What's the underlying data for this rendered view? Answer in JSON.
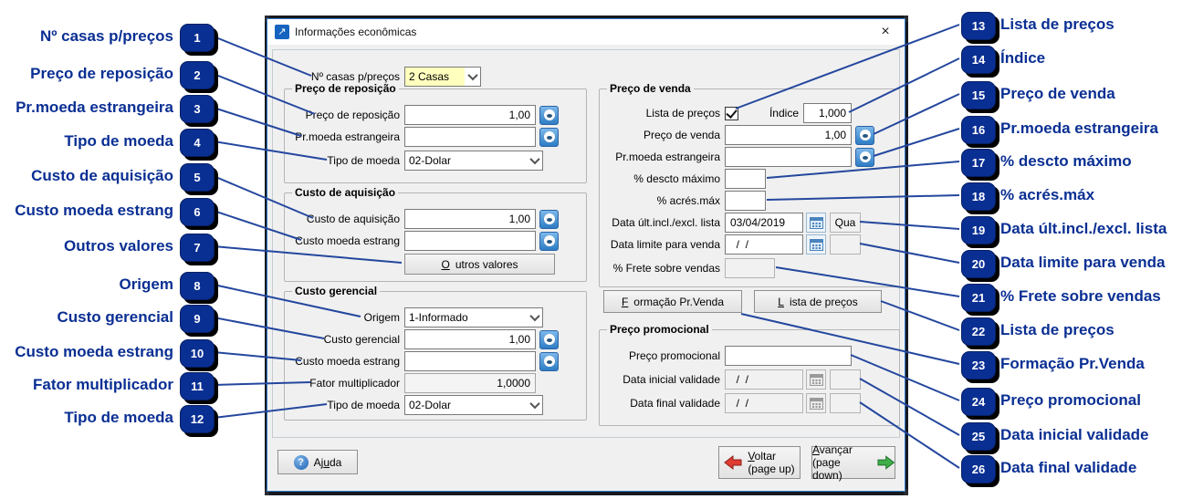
{
  "window": {
    "title": "Informações econômicas",
    "close_glyph": "×",
    "app_icon_glyph": "↗"
  },
  "header_field": {
    "label": "Nº casas p/preços",
    "value": "2 Casas"
  },
  "groups": {
    "preco_reposicao": {
      "title": "Preço de reposição",
      "preco_reposicao": {
        "label": "Preço de reposição",
        "value": "1,00"
      },
      "pr_moeda_estrangeira": {
        "label": "Pr.moeda estrangeira",
        "value": ""
      },
      "tipo_moeda": {
        "label": "Tipo de moeda",
        "value": "02-Dolar"
      }
    },
    "custo_aquisicao": {
      "title": "Custo de aquisição",
      "custo_aquisicao": {
        "label": "Custo de aquisição",
        "value": "1,00"
      },
      "custo_moeda_estrang": {
        "label": "Custo moeda estrang",
        "value": ""
      },
      "outros_valores": {
        "label": "Outros valores",
        "accel": 0
      }
    },
    "custo_gerencial": {
      "title": "Custo gerencial",
      "origem": {
        "label": "Origem",
        "value": "1-Informado"
      },
      "custo_gerencial": {
        "label": "Custo gerencial",
        "value": "1,00"
      },
      "custo_moeda_estrang": {
        "label": "Custo moeda estrang",
        "value": ""
      },
      "fator_multiplicador": {
        "label": "Fator multiplicador",
        "value": "1,0000"
      },
      "tipo_moeda": {
        "label": "Tipo de moeda",
        "value": "02-Dolar"
      }
    },
    "preco_venda": {
      "title": "Preço de venda",
      "lista_precos": {
        "label": "Lista de preços",
        "checked": true
      },
      "indice": {
        "label": "Índice",
        "value": "1,000"
      },
      "preco_venda": {
        "label": "Preço de venda",
        "value": "1,00"
      },
      "pr_moeda_estrangeira": {
        "label": "Pr.moeda estrangeira",
        "value": ""
      },
      "descto_maximo": {
        "label": "% descto máximo",
        "value": ""
      },
      "acres_max": {
        "label": "% acrés.máx",
        "value": ""
      },
      "data_ult_incl_excl": {
        "label": "Data últ.incl./excl. lista",
        "value": "03/04/2019",
        "day": "Qua"
      },
      "data_limite_venda": {
        "label": "Data limite para venda",
        "value": "  /  /",
        "day": ""
      },
      "frete_sobre_vendas": {
        "label": "% Frete sobre vendas",
        "value": ""
      },
      "btn_formacao": {
        "label": "Formação Pr.Venda",
        "accel": 0
      },
      "btn_lista": {
        "label": "Lista de preços",
        "accel": 0
      }
    },
    "preco_promocional": {
      "title": "Preço promocional",
      "preco_promocional": {
        "label": "Preço promocional",
        "value": ""
      },
      "data_inicial": {
        "label": "Data inicial validade",
        "value": "  /  /",
        "day": ""
      },
      "data_final": {
        "label": "Data final validade",
        "value": "  /  /",
        "day": ""
      }
    }
  },
  "footer": {
    "ajuda": {
      "label": "Ajuda",
      "accel": 2,
      "icon_glyph": "?"
    },
    "voltar": {
      "label": "Voltar",
      "accel": 0,
      "sub": "(page up)"
    },
    "avancar": {
      "label": "Avançar",
      "accel": 0,
      "sub": "(page down)"
    }
  },
  "callouts": {
    "left": [
      {
        "num": "1",
        "label": "Nº casas p/preços"
      },
      {
        "num": "2",
        "label": "Preço de reposição"
      },
      {
        "num": "3",
        "label": "Pr.moeda estrangeira"
      },
      {
        "num": "4",
        "label": "Tipo de moeda"
      },
      {
        "num": "5",
        "label": "Custo de aquisição"
      },
      {
        "num": "6",
        "label": "Custo moeda estrang"
      },
      {
        "num": "7",
        "label": "Outros valores"
      },
      {
        "num": "8",
        "label": "Origem"
      },
      {
        "num": "9",
        "label": "Custo gerencial"
      },
      {
        "num": "10",
        "label": "Custo moeda estrang"
      },
      {
        "num": "11",
        "label": "Fator multiplicador"
      },
      {
        "num": "12",
        "label": "Tipo de moeda"
      }
    ],
    "right": [
      {
        "num": "13",
        "label": "Lista de preços"
      },
      {
        "num": "14",
        "label": "Índice"
      },
      {
        "num": "15",
        "label": "Preço de venda"
      },
      {
        "num": "16",
        "label": "Pr.moeda estrangeira"
      },
      {
        "num": "17",
        "label": "% descto máximo"
      },
      {
        "num": "18",
        "label": "% acrés.máx"
      },
      {
        "num": "19",
        "label": "Data últ.incl./excl. lista"
      },
      {
        "num": "20",
        "label": "Data limite para venda"
      },
      {
        "num": "21",
        "label": "% Frete sobre vendas"
      },
      {
        "num": "22",
        "label": "Lista de preços"
      },
      {
        "num": "23",
        "label": "Formação Pr.Venda"
      },
      {
        "num": "24",
        "label": "Preço promocional"
      },
      {
        "num": "25",
        "label": "Data inicial validade"
      },
      {
        "num": "26",
        "label": "Data final validade"
      }
    ]
  },
  "colors": {
    "callout_navy": "#0a2f93",
    "connector_blue": "#24479e",
    "highlight_yellow": "#ffffbe",
    "window_border_blue": "#2f79c8",
    "back_arrow_red": "#e03c31",
    "forward_arrow_green": "#3fae49",
    "value_button_blue": "#2e7cc4"
  }
}
